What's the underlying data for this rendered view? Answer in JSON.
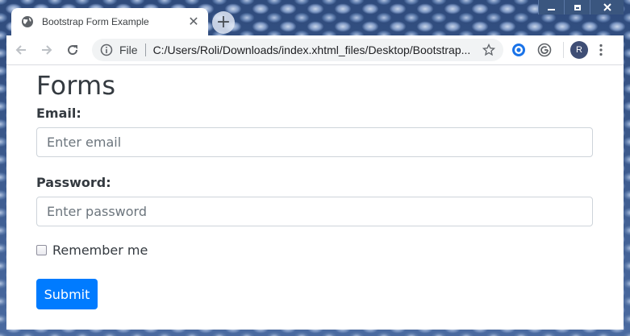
{
  "window": {
    "controls": [
      "minimize",
      "maximize",
      "close"
    ]
  },
  "tab": {
    "title": "Bootstrap Form Example",
    "favicon": "globe-icon",
    "close_glyph": "✕"
  },
  "new_tab": {
    "glyph": "+"
  },
  "toolbar": {
    "omnibox": {
      "scheme_label": "File",
      "url": "C:/Users/Roli/Downloads/index.xhtml_files/Desktop/Bootstrap..."
    },
    "profile_initial": "R"
  },
  "page": {
    "title": "Forms",
    "email_label": "Email:",
    "email_placeholder": "Enter email",
    "password_label": "Password:",
    "password_placeholder": "Enter password",
    "remember_label": "Remember me",
    "submit_label": "Submit"
  },
  "colors": {
    "primary": "#007bff",
    "text": "#343a40"
  }
}
